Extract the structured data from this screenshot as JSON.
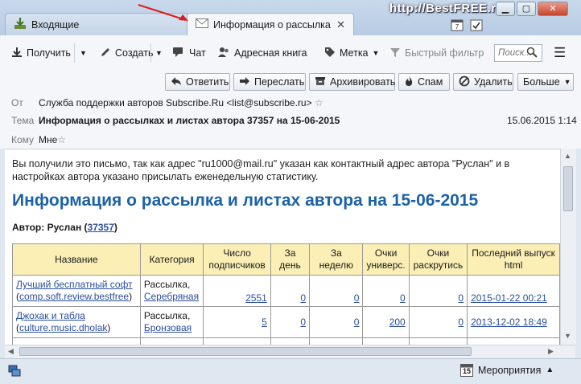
{
  "tabs": {
    "inbox_label": "Входящие",
    "message_label": "Информация о рассылка..."
  },
  "watermark": "http://BestFREE.ru",
  "toolbar": {
    "get": "Получить",
    "create": "Создать",
    "chat": "Чат",
    "address_book": "Адресная книга",
    "tag": "Метка",
    "quick_filter": "Быстрый фильтр",
    "search_placeholder": "Поиск..."
  },
  "actions": {
    "reply": "Ответить",
    "forward": "Переслать",
    "archive": "Архивировать",
    "spam": "Спам",
    "delete": "Удалить",
    "more": "Больше"
  },
  "header": {
    "from_label": "От",
    "from_value": "Служба поддержки авторов Subscribe.Ru <list@subscribe.ru>",
    "subject_label": "Тема",
    "subject_value": "Информация о рассылках и листах автора 37357 на 15-06-2015",
    "date": "15.06.2015 1:14",
    "to_label": "Кому",
    "to_value": "Мне"
  },
  "body": {
    "intro": "Вы получили это письмо, так как адрес \"ru1000@mail.ru\" указан как контактный адрес автора \"Руслан\" и в настройках автора указано присылать еженедельную статистику.",
    "title": "Информация о рассылка и листах автора на 15-06-2015",
    "author_prefix": "Автор: Руслан (",
    "author_id": "37357",
    "author_suffix": ")"
  },
  "table": {
    "headers": [
      "Название",
      "Категория",
      "Число подписчиков",
      "За день",
      "За неделю",
      "Очки универс.",
      "Очки раскрутись",
      "Последний выпуск html"
    ],
    "rows": [
      {
        "name": "Лучший бесплатный софт",
        "code": "comp.soft.review.bestfree",
        "category": "Рассылка,",
        "category_link": "Серебряная",
        "subscribers": "2551",
        "day": "0",
        "week": "0",
        "univ": "0",
        "promo": "0",
        "last": "2015-01-22 00:21"
      },
      {
        "name": "Джохак и табла",
        "code": "culture.music.dholak",
        "category": "Рассылка,",
        "category_link": "Бронзовая",
        "subscribers": "5",
        "day": "0",
        "week": "0",
        "univ": "200",
        "promo": "0",
        "last": "2013-12-02 18:49"
      }
    ]
  },
  "status": {
    "calendar_day": "15",
    "events": "Мероприятия"
  }
}
